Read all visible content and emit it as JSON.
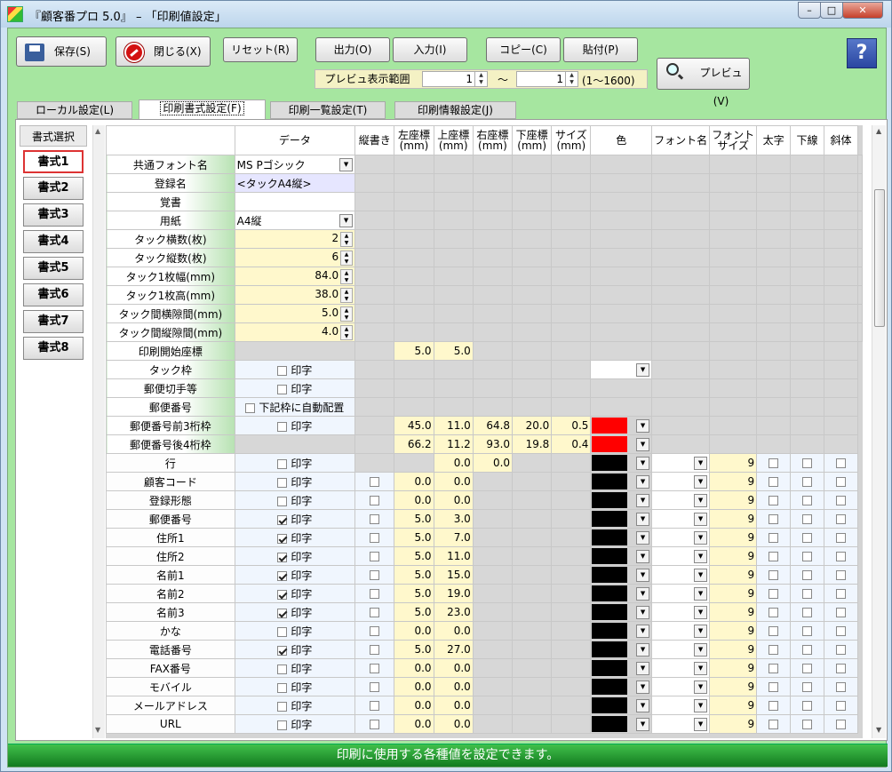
{
  "window": {
    "title": "『顧客番プロ 5.0』 – 「印刷値設定」",
    "min": "–",
    "max": "□",
    "close": "✕"
  },
  "toolbar": {
    "save": "保存(S)",
    "close": "閉じる(X)",
    "reset": "リセット(R)",
    "output": "出力(O)",
    "input": "入力(I)",
    "copy": "コピー(C)",
    "paste": "貼付(P)",
    "preview": "プレビュ(V)",
    "help": "?"
  },
  "preview_range": {
    "label": "プレビュ表示範囲",
    "from": "1",
    "to": "1",
    "sep": "～",
    "hint": "(1～1600)"
  },
  "tabs": [
    "ローカル設定(L)",
    "印刷書式設定(F)",
    "印刷一覧設定(T)",
    "印刷情報設定(J)"
  ],
  "formats": {
    "header": "書式選択",
    "items": [
      "書式1",
      "書式2",
      "書式3",
      "書式4",
      "書式5",
      "書式6",
      "書式7",
      "書式8"
    ]
  },
  "grid": {
    "headers": [
      "データ",
      "縦書き",
      "左座標\n(mm)",
      "上座標\n(mm)",
      "右座標\n(mm)",
      "下座標\n(mm)",
      "サイズ\n(mm)",
      "色",
      "フォント名",
      "フォント\nサイズ",
      "太字",
      "下線",
      "斜体"
    ],
    "settings": [
      {
        "label": "共通フォント名",
        "kind": "combo",
        "value": "MS Pゴシック"
      },
      {
        "label": "登録名",
        "kind": "text",
        "value": "<タックA4縦>",
        "bg": "lav"
      },
      {
        "label": "覚書",
        "kind": "text",
        "value": "",
        "bg": "wh"
      },
      {
        "label": "用紙",
        "kind": "combo",
        "value": "A4縦",
        "bg": "wh"
      },
      {
        "label": "タック横数(枚)",
        "kind": "spin",
        "value": "2"
      },
      {
        "label": "タック縦数(枚)",
        "kind": "spin",
        "value": "6"
      },
      {
        "label": "タック1枚幅(mm)",
        "kind": "spin",
        "value": "84.0"
      },
      {
        "label": "タック1枚高(mm)",
        "kind": "spin",
        "value": "38.0"
      },
      {
        "label": "タック間横隙間(mm)",
        "kind": "spin",
        "value": "5.0"
      },
      {
        "label": "タック間縦隙間(mm)",
        "kind": "spin",
        "value": "4.0"
      }
    ],
    "start": {
      "label": "印刷開始座標",
      "left": "5.0",
      "top": "5.0"
    },
    "frames": [
      {
        "label": "タック枠",
        "check": "印字",
        "checked": false,
        "color": "white"
      },
      {
        "label": "郵便切手等",
        "check": "印字",
        "checked": false
      },
      {
        "label": "郵便番号",
        "check": "下記枠に自動配置",
        "checked": false
      },
      {
        "label": "郵便番号前3桁枠",
        "check": "印字",
        "checked": false,
        "left": "45.0",
        "top": "11.0",
        "right": "64.8",
        "bottom": "20.0",
        "size": "0.5",
        "color": "red"
      },
      {
        "label": "郵便番号後4桁枠",
        "check": null,
        "left": "66.2",
        "top": "11.2",
        "right": "93.0",
        "bottom": "19.8",
        "size": "0.4",
        "color": "red"
      }
    ],
    "line": {
      "label": "行",
      "check": "印字",
      "top": "0.0",
      "right": "0.0",
      "fsize": "9"
    },
    "fields": [
      {
        "label": "顧客コード",
        "checked": false,
        "left": "0.0",
        "top": "0.0",
        "fsize": "9"
      },
      {
        "label": "登録形態",
        "checked": false,
        "left": "0.0",
        "top": "0.0",
        "fsize": "9"
      },
      {
        "label": "郵便番号",
        "checked": true,
        "left": "5.0",
        "top": "3.0",
        "fsize": "9"
      },
      {
        "label": "住所1",
        "checked": true,
        "left": "5.0",
        "top": "7.0",
        "fsize": "9"
      },
      {
        "label": "住所2",
        "checked": true,
        "left": "5.0",
        "top": "11.0",
        "fsize": "9"
      },
      {
        "label": "名前1",
        "checked": true,
        "left": "5.0",
        "top": "15.0",
        "fsize": "9"
      },
      {
        "label": "名前2",
        "checked": true,
        "left": "5.0",
        "top": "19.0",
        "fsize": "9"
      },
      {
        "label": "名前3",
        "checked": true,
        "left": "5.0",
        "top": "23.0",
        "fsize": "9"
      },
      {
        "label": "かな",
        "checked": false,
        "left": "0.0",
        "top": "0.0",
        "fsize": "9"
      },
      {
        "label": "電話番号",
        "checked": true,
        "left": "5.0",
        "top": "27.0",
        "fsize": "9"
      },
      {
        "label": "FAX番号",
        "checked": false,
        "left": "0.0",
        "top": "0.0",
        "fsize": "9"
      },
      {
        "label": "モバイル",
        "checked": false,
        "left": "0.0",
        "top": "0.0",
        "fsize": "9"
      },
      {
        "label": "メールアドレス",
        "checked": false,
        "left": "0.0",
        "top": "0.0",
        "fsize": "9"
      },
      {
        "label": "URL",
        "checked": false,
        "left": "0.0",
        "top": "0.0",
        "fsize": "9"
      }
    ],
    "print_label": "印字"
  },
  "status": "印刷に使用する各種値を設定できます。",
  "colors": {
    "accent_green": "#a6e6a0",
    "status_green": "#1f9a2c",
    "red_swatch": "#ff0000",
    "black_swatch": "#000000"
  }
}
